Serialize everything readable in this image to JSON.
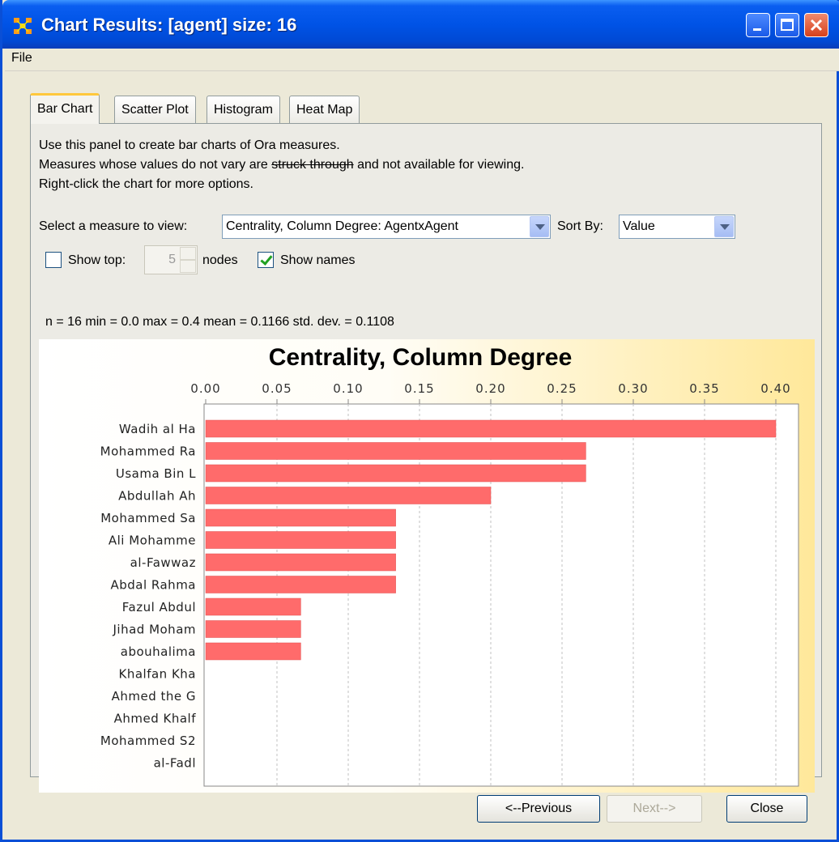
{
  "window": {
    "title": "Chart Results: [agent] size: 16"
  },
  "menu": {
    "file": "File"
  },
  "tabs": [
    {
      "label": "Bar Chart",
      "active": true
    },
    {
      "label": "Scatter Plot",
      "active": false
    },
    {
      "label": "Histogram",
      "active": false
    },
    {
      "label": "Heat Map",
      "active": false
    }
  ],
  "description": {
    "line1": "Use this panel to create bar charts of Ora measures.",
    "line2_a": "Measures whose values do not vary are ",
    "line2_strike": "struck through",
    "line2_b": " and not available for viewing.",
    "line3": "Right-click the chart for more options."
  },
  "controls": {
    "measure_label": "Select a measure to view:",
    "measure_value": "Centrality, Column Degree: AgentxAgent",
    "sort_label": "Sort By:",
    "sort_value": "Value",
    "show_top_label": "Show top:",
    "show_top_checked": false,
    "show_top_value": "5",
    "nodes_label": "nodes",
    "show_names_label": "Show names",
    "show_names_checked": true
  },
  "stats": "n = 16  min = 0.0  max = 0.4  mean = 0.1166  std. dev.  = 0.1108",
  "buttons": {
    "previous": "<--Previous",
    "next": "Next-->",
    "close": "Close"
  },
  "colors": {
    "bar": "#ff6b6b",
    "accent": "#0053e6"
  },
  "chart_data": {
    "type": "bar",
    "orientation": "horizontal",
    "title": "Centrality, Column Degree",
    "xlim": [
      0,
      0.42
    ],
    "ticks": [
      0.0,
      0.05,
      0.1,
      0.15,
      0.2,
      0.25,
      0.3,
      0.35,
      0.4
    ],
    "tick_labels": [
      "0.00",
      "0.05",
      "0.10",
      "0.15",
      "0.20",
      "0.25",
      "0.30",
      "0.35",
      "0.40"
    ],
    "grid": true,
    "categories": [
      "Wadih al Ha",
      "Mohammed Ra",
      "Usama Bin L",
      "Abdullah Ah",
      "Mohammed Sa",
      "Ali Mohamme",
      "al-Fawwaz",
      "Abdal Rahma",
      "Fazul Abdul",
      "Jihad Moham",
      "abouhalima",
      "Khalfan Kha",
      "Ahmed the G",
      "Ahmed Khalf",
      "Mohammed S2",
      "al-Fadl"
    ],
    "values": [
      0.4,
      0.2667,
      0.2667,
      0.2,
      0.1333,
      0.1333,
      0.1333,
      0.1333,
      0.0667,
      0.0667,
      0.0667,
      0.0,
      0.0,
      0.0,
      0.0,
      0.0
    ]
  }
}
